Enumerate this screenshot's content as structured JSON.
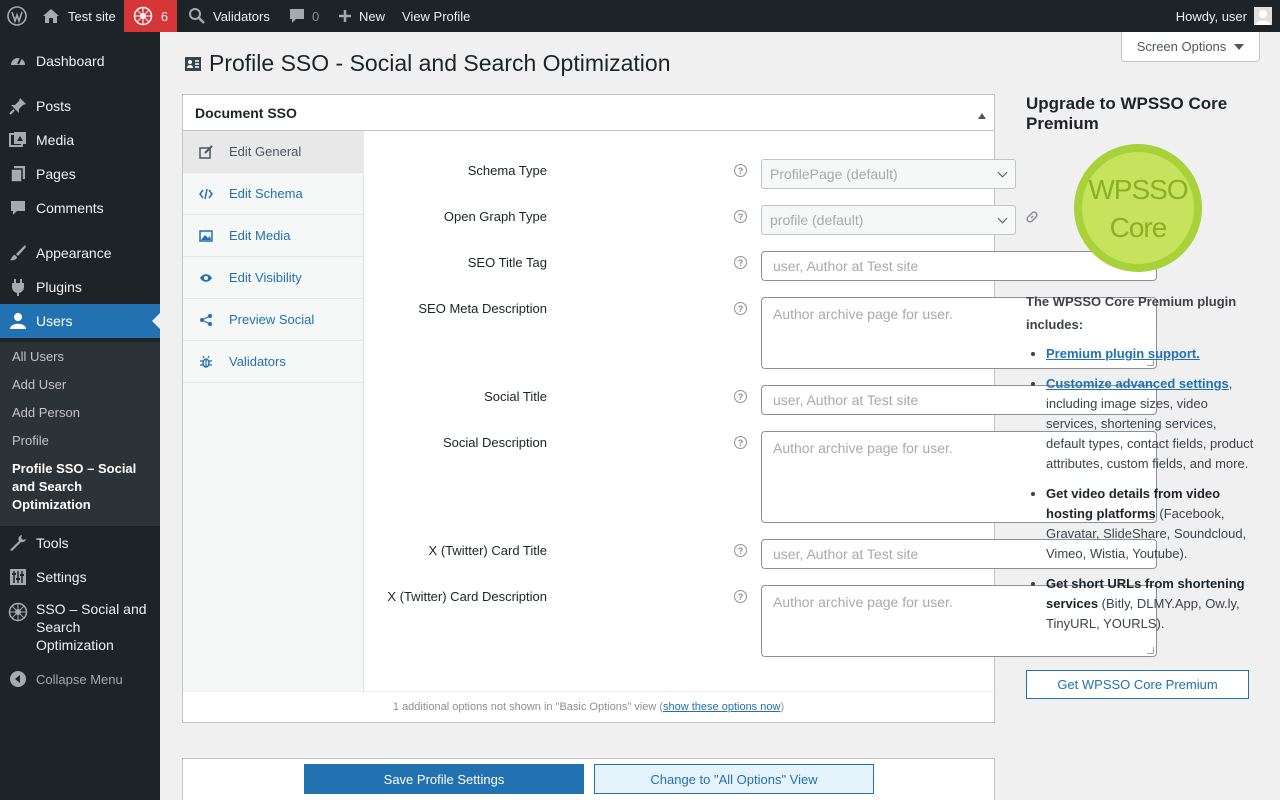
{
  "adminbar": {
    "site_name": "Test site",
    "sso_count": "6",
    "validators": "Validators",
    "comments_count": "0",
    "new": "New",
    "view_profile": "View Profile",
    "howdy": "Howdy, user"
  },
  "menu": {
    "dashboard": "Dashboard",
    "posts": "Posts",
    "media": "Media",
    "pages": "Pages",
    "comments": "Comments",
    "appearance": "Appearance",
    "plugins": "Plugins",
    "users": "Users",
    "submenu": {
      "all_users": "All Users",
      "add_user": "Add User",
      "add_person": "Add Person",
      "profile": "Profile",
      "profile_sso": "Profile SSO – Social and Search Optimization"
    },
    "tools": "Tools",
    "settings": "Settings",
    "sso": "SSO – Social and Search Optimization",
    "collapse": "Collapse Menu"
  },
  "page": {
    "title": "Profile SSO - Social and Search Optimization",
    "screen_options": "Screen Options"
  },
  "metabox": {
    "title": "Document SSO",
    "tabs": [
      "Edit General",
      "Edit Schema",
      "Edit Media",
      "Edit Visibility",
      "Preview Social",
      "Validators"
    ],
    "fields": {
      "schema_type": {
        "label": "Schema Type",
        "value": "ProfilePage (default)"
      },
      "og_type": {
        "label": "Open Graph Type",
        "value": "profile (default)"
      },
      "seo_title": {
        "label": "SEO Title Tag",
        "placeholder": "user, Author at Test site"
      },
      "seo_desc": {
        "label": "SEO Meta Description",
        "placeholder": "Author archive page for user."
      },
      "social_title": {
        "label": "Social Title",
        "placeholder": "user, Author at Test site"
      },
      "social_desc": {
        "label": "Social Description",
        "placeholder": "Author archive page for user."
      },
      "x_title": {
        "label": "X (Twitter) Card Title",
        "placeholder": "user, Author at Test site"
      },
      "x_desc": {
        "label": "X (Twitter) Card Description",
        "placeholder": "Author archive page for user."
      }
    },
    "help_glyph": "?",
    "footnote_prefix": "1 additional options not shown in \"Basic Options\" view (",
    "footnote_link": "show these options now",
    "footnote_suffix": ")"
  },
  "buttons": {
    "save": "Save Profile Settings",
    "change_view": "Change to \"All Options\" View"
  },
  "promo": {
    "title": "Upgrade to WPSSO Core Premium",
    "logo_line1": "WPSSO",
    "logo_line2": "Core",
    "intro": "The WPSSO Core Premium plugin includes:",
    "items": {
      "support_link": "Premium plugin support.",
      "custom_link": "Customize advanced settings",
      "custom_rest": ", including image sizes, video services, shortening services, default types, contact fields, product attributes, custom fields, and more.",
      "video_bold": "Get video details from video hosting platforms",
      "video_rest": " (Facebook, Gravatar, SlideShare, Soundcloud, Vimeo, Wistia, Youtube).",
      "short_bold": "Get short URLs from shortening services",
      "short_rest": " (Bitly, DLMY.App, Ow.ly, TinyURL, YOURLS)."
    },
    "button": "Get WPSSO Core Premium"
  },
  "colors": {
    "admin_dark": "#1d2327",
    "accent_blue": "#2271b1",
    "badge_red": "#d63638",
    "lime": "#a8d23a"
  },
  "icons": [
    "wordpress-icon",
    "home-icon",
    "sso-icon",
    "search-icon",
    "comment-icon",
    "plus-icon",
    "avatar-icon",
    "dashboard-icon",
    "pin-icon",
    "media-icon",
    "pages-icon",
    "appearance-icon",
    "plugins-icon",
    "users-icon",
    "tools-icon",
    "settings-icon",
    "collapse-icon",
    "profile-card-icon",
    "edit-icon",
    "code-icon",
    "image-icon",
    "eye-icon",
    "share-icon",
    "bug-icon",
    "link-icon"
  ]
}
